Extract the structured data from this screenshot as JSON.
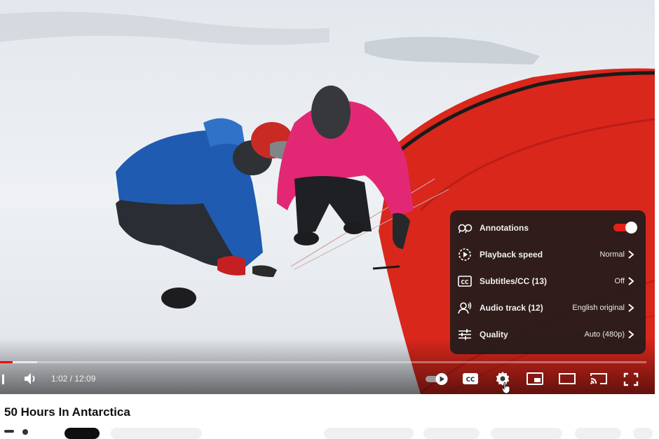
{
  "video": {
    "title": "50 Hours In Antarctica",
    "time_display": "1:02 / 12:09",
    "progress": {
      "played_fraction": 0.019,
      "loaded_fraction": 0.058
    }
  },
  "settings_menu": {
    "items": [
      {
        "icon": "annotations-icon",
        "label": "Annotations",
        "value": "",
        "toggle_on": true
      },
      {
        "icon": "playback-speed-icon",
        "label": "Playback speed",
        "value": "Normal"
      },
      {
        "icon": "subtitles-icon",
        "label": "Subtitles/CC (13)",
        "value": "Off"
      },
      {
        "icon": "audio-track-icon",
        "label": "Audio track (12)",
        "value": "English original"
      },
      {
        "icon": "quality-icon",
        "label": "Quality",
        "value": "Auto (480p)"
      }
    ]
  },
  "colors": {
    "accent": "#ff0000",
    "toggle_on": "#e62117",
    "menu_bg": "#1c1c1c"
  },
  "controls": {
    "icons": [
      "next-icon",
      "volume-icon",
      "autoplay-toggle-icon",
      "captions-icon",
      "settings-gear-icon",
      "miniplayer-icon",
      "theater-mode-icon",
      "cast-icon",
      "fullscreen-icon"
    ]
  }
}
